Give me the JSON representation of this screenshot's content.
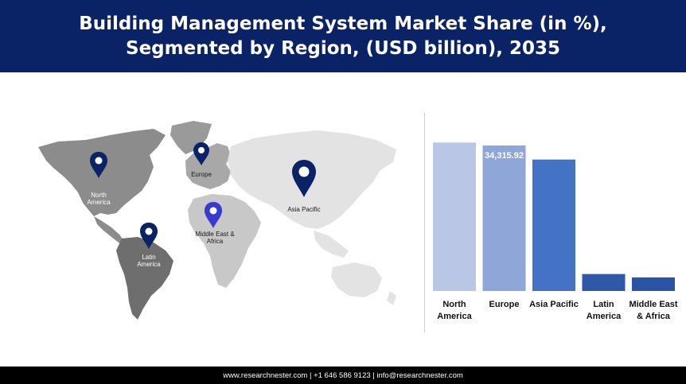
{
  "header": {
    "title": "Building Management System Market Share (in %), Segmented by Region, (USD billion), 2035"
  },
  "map": {
    "regions": [
      {
        "name": "North America",
        "label_lines": [
          "North",
          "America"
        ],
        "pin_color": "#0a2266"
      },
      {
        "name": "Europe",
        "label_lines": [
          "Europe"
        ],
        "pin_color": "#0a2266"
      },
      {
        "name": "Asia Pacific",
        "label_lines": [
          "Asia Pacific"
        ],
        "pin_color": "#0a2266"
      },
      {
        "name": "Middle East & Africa",
        "label_lines": [
          "Middle East &",
          "Africa"
        ],
        "pin_color": "#3a3ad0"
      },
      {
        "name": "Latin America",
        "label_lines": [
          "Latin",
          "America"
        ],
        "pin_color": "#0a2266"
      }
    ]
  },
  "chart_data": {
    "type": "bar",
    "categories": [
      "North America",
      "Europe",
      "Asia Pacific",
      "Latin America",
      "Middle East & Africa"
    ],
    "category_label_lines": [
      [
        "North",
        "America"
      ],
      [
        "Europe"
      ],
      [
        "Asia Pacific"
      ],
      [
        "Latin",
        "America"
      ],
      [
        "Middle East",
        "& Africa"
      ]
    ],
    "values": [
      35000,
      34315.92,
      31000,
      4000,
      3200
    ],
    "colors": [
      "#b9c6e6",
      "#8fa6d9",
      "#4472c4",
      "#2f58a8",
      "#2b54a5"
    ],
    "data_labels": [
      {
        "category": "Europe",
        "text": "34,315.92"
      }
    ],
    "ylim": [
      0,
      36000
    ],
    "grid": false,
    "legend": "none",
    "title": "",
    "xlabel": "",
    "ylabel": ""
  },
  "footer": {
    "text": "www.researchnester.com | +1 646 586 9123 | info@researchnester.com"
  }
}
